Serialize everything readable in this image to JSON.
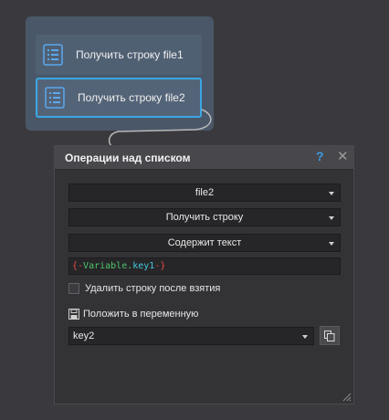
{
  "canvas": {
    "nodes": [
      {
        "label": "Получить строку file1",
        "icon": "list-icon",
        "selected": false
      },
      {
        "label": "Получить строку file2",
        "icon": "list-icon",
        "selected": true
      }
    ]
  },
  "panel": {
    "title": "Операции над списком",
    "help_label": "?",
    "close_label": "✕",
    "selects": [
      {
        "value": "file2"
      },
      {
        "value": "Получить строку"
      },
      {
        "value": "Содержит текст"
      }
    ],
    "variable_expression": {
      "open": "{-",
      "namespace": "Variable",
      "dot": ".",
      "key": "key1",
      "close": "-}"
    },
    "delete_after_take": {
      "label": "Удалить строку после взятия",
      "checked": false
    },
    "save_to_variable": {
      "label": "Положить в переменную",
      "value": "key2"
    }
  },
  "colors": {
    "selection_border": "#3aa6e6",
    "group_bg": "#4a5768",
    "bracket_red": "#e84b3c",
    "variable_green": "#4fc46c",
    "key_cyan": "#48c6e0"
  }
}
